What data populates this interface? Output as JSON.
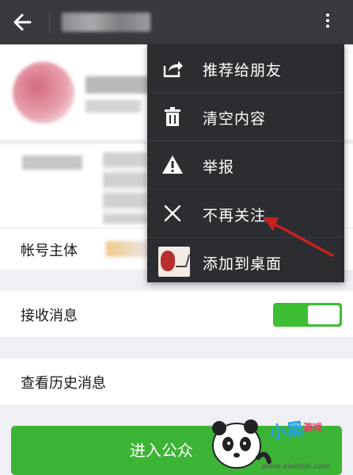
{
  "topbar": {
    "back_icon": "arrow-left-icon",
    "more_icon": "more-vertical-icon"
  },
  "profile": {},
  "subject": {
    "label": "帐号主体"
  },
  "receive": {
    "label": "接收消息",
    "toggle_on": true
  },
  "history": {
    "label": "查看历史消息"
  },
  "enter_button": {
    "label": "进入公众"
  },
  "menu": {
    "items": [
      {
        "label": "推荐给朋友",
        "icon": "share-icon"
      },
      {
        "label": "清空内容",
        "icon": "trash-icon"
      },
      {
        "label": "举报",
        "icon": "warning-icon"
      },
      {
        "label": "不再关注",
        "icon": "close-icon"
      },
      {
        "label": "添加到桌面",
        "icon": "app-thumbnail-icon"
      }
    ]
  },
  "colors": {
    "topbar": "#393a3f",
    "menu": "#2c2d31",
    "accent_green": "#3cb435",
    "annotation_red": "#c8201e"
  },
  "watermark": {
    "brand": "小黑",
    "sub": "游戏",
    "url": "www.xiaohei.com"
  }
}
